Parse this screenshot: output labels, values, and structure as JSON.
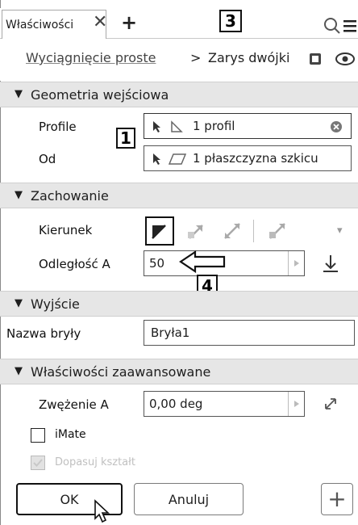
{
  "tab": {
    "title": "Właściwości",
    "close": "✕",
    "add": "+"
  },
  "callouts": {
    "c1": "1",
    "c3": "3",
    "c4": "4"
  },
  "breadcrumb": {
    "item1": "Wyciągnięcie proste",
    "separator": ">",
    "item2": "Zarys dwójki"
  },
  "sections": {
    "input_geometry": {
      "title": "Geometria wejściowa",
      "toggle": "▼"
    },
    "behavior": {
      "title": "Zachowanie",
      "toggle": "▼"
    },
    "output": {
      "title": "Wyjście",
      "toggle": "▼"
    },
    "advanced": {
      "title": "Właściwości zaawansowane",
      "toggle": "▼"
    }
  },
  "input_geometry": {
    "profile_label": "Profile",
    "profile_value": "1 profil",
    "from_label": "Od",
    "from_value": "1 płaszczyzna szkicu"
  },
  "behavior": {
    "direction_label": "Kierunek",
    "direction_dropdown": "▾",
    "distance_label": "Odległość A",
    "distance_value": "50"
  },
  "output": {
    "body_name_label": "Nazwa bryły",
    "body_name_value": "Bryła1"
  },
  "advanced": {
    "taper_label": "Zwężenie A",
    "taper_value": "0,00 deg",
    "imate_label": "iMate",
    "fit_shape_label": "Dopasuj kształt"
  },
  "buttons": {
    "ok": "OK",
    "cancel": "Anuluj",
    "add": "+"
  },
  "icons": {
    "search": "search-icon",
    "menu": "menu-icon",
    "view_cube": "cube-icon",
    "visibility": "eye-icon",
    "cursor": "cursor-icon"
  }
}
